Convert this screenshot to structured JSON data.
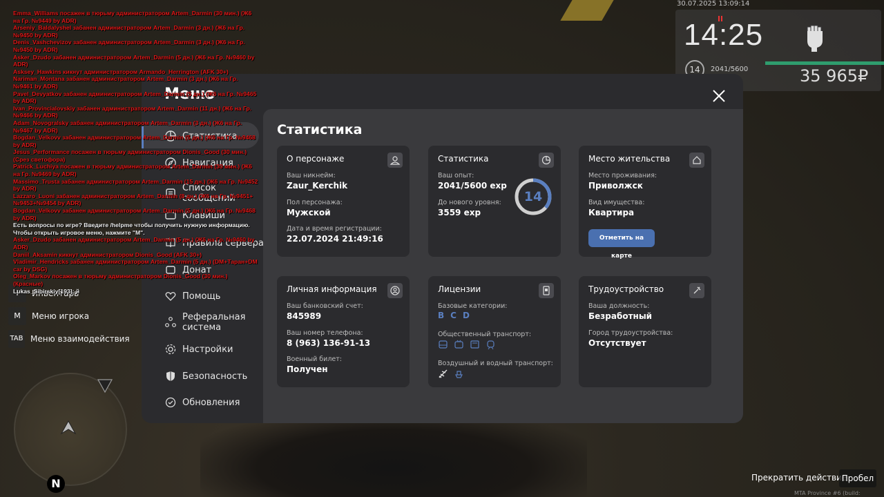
{
  "hud": {
    "datetime": "30.07.2025 13:09:14",
    "time": "14:25",
    "level": "14",
    "exp": "2041/5600",
    "money": "35 965₽"
  },
  "menu": {
    "title": "Меню",
    "nav": [
      {
        "label": "Статистика",
        "icon": "chart-icon"
      },
      {
        "label": "Навигация",
        "icon": "compass-icon"
      },
      {
        "label": "Список сообщений",
        "icon": "list-icon"
      },
      {
        "label": "Клавиши",
        "icon": "keyboard-icon"
      },
      {
        "label": "Правила сервера",
        "icon": "book-icon"
      },
      {
        "label": "Донат",
        "icon": "donate-icon"
      },
      {
        "label": "Помощь",
        "icon": "heart-hand-icon"
      },
      {
        "label": "Реферальная система",
        "icon": "referral-icon"
      },
      {
        "label": "Настройки",
        "icon": "gear-icon"
      },
      {
        "label": "Безопасность",
        "icon": "shield-icon"
      },
      {
        "label": "Обновления",
        "icon": "update-icon"
      }
    ]
  },
  "stats": {
    "title": "Статистика",
    "character": {
      "title": "О персонаже",
      "nick_label": "Ваш никнейм:",
      "nick": "Zaur_Kerchik",
      "gender_label": "Пол персонажа:",
      "gender": "Мужской",
      "reg_label": "Дата и время регистрации:",
      "reg": "22.07.2024 21:49:16"
    },
    "statistics": {
      "title": "Статистика",
      "exp_label": "Ваш опыт:",
      "exp": "2041/5600 exp",
      "next_label": "До нового уровня:",
      "next": "3559 exp",
      "level": "14",
      "progress": 0.364
    },
    "residence": {
      "title": "Место жительства",
      "place_label": "Место проживания:",
      "place": "Приволжск",
      "property_label": "Вид имущества:",
      "property": "Квартира",
      "map_button": "Отметить на карте"
    },
    "personal": {
      "title": "Личная информация",
      "bank_label": "Ваш банковский счет:",
      "bank": "845989",
      "phone_label": "Ваш номер телефона:",
      "phone": "8 (963) 136-91-13",
      "military_label": "Военный билет:",
      "military": "Получен"
    },
    "licenses": {
      "title": "Лицензии",
      "base_label": "Базовые категории:",
      "categories": [
        "B",
        "C",
        "D"
      ],
      "public_label": "Общественный транспорт:",
      "air_label": "Воздушный и водный транспорт:"
    },
    "employment": {
      "title": "Трудоустройство",
      "position_label": "Ваша должность:",
      "position": "Безработный",
      "city_label": "Город трудоустройства:",
      "city": "Отсутствует"
    }
  },
  "hotkeys": [
    {
      "key": "M",
      "label": "Меню игрока"
    },
    {
      "key": "TAB",
      "label": "Меню взаимодействия"
    },
    {
      "key": "I",
      "label": "Инвентарь"
    }
  ],
  "minimap": {
    "north": "N"
  },
  "bottom": {
    "stop_action": "Прекратить действие",
    "key": "Пробел",
    "build": "MTA Province #6 (build: 6.124.15.9)"
  },
  "chat": [
    {
      "text": "Emma_Williams посажен в тюрьму администратором Artem_Darmin (30 мин.) (Ж6 на Гр. №9449 by ADR)",
      "type": "red"
    },
    {
      "text": "Arseniy_Baldalyshel забанен администратором Artem_Darmin (3 дн.) (Ж6 на Гр. №9450 by ADR)",
      "type": "red"
    },
    {
      "text": "Denis_Vashchevizov забанен администратором Artem_Darmin (3 дн.) (Ж6 на Гр. №9450 by ADR)",
      "type": "red"
    },
    {
      "text": "Asker_Dzudo забанен администратором Artem_Darmin (5 дн.) (Ж6 на Гр. №9460 by ADR)",
      "type": "red"
    },
    {
      "text": "Asksey_Hawkins кикнут администратором Armando_Herrington (AFK 30+)",
      "type": "red"
    },
    {
      "text": "Nariman_Montana забанен администратором Artem_Darmin (3 дн.) (Ж6 на Гр. №9461 by ADR)",
      "type": "red"
    },
    {
      "text": "Pavel_Devyatkov забанен администратором Artem_Darmin (5 дн.) (Ж6 на Гр. №9465 by ADR)",
      "type": "red"
    },
    {
      "text": "Ivan_Provincialovskiy забанен администратором Artem_Darmin (11 дн.) (Ж6 на Гр. №9466 by ADR)",
      "type": "red"
    },
    {
      "text": "Adam_Novogralsky забанен администратором Artem_Darmin (3 дн.) (Ж6 на Гр. №9467 by ADR)",
      "type": "red"
    },
    {
      "text": "Bogdan_Velkovv забанен администратором Artem_Darmin (5 дн.) (Ж6 на Гр. №9468 by ADR)",
      "type": "red"
    },
    {
      "text": "Jesus_Performance посажен в тюрьму администратором Dionis_Good (30 мин.) (Срез светофора)",
      "type": "red"
    },
    {
      "text": "Patrick_Luchiya посажен в тюрьму администратором Artem_Darmin (30 мин.) (Ж6 на Гр. №9469 by ADR)",
      "type": "red"
    },
    {
      "text": "Massimo_Trusta забанен администратором Artem_Darmin (15 дн.) (Ж6 на Гр. №9452 by ADR)",
      "type": "red"
    },
    {
      "text": "Lazzaro_Luoni забанен администратором Artem_Darmin (8 дн.) (Ж6 на Гр. №9451+№9453+№9454 by ADR)",
      "type": "red"
    },
    {
      "text": "Bogdan_Velkovv забанен администратором Artem_Darmin (5 дн.) (Ж6 на Гр. №9468 by ADR)",
      "type": "red"
    },
    {
      "text": "Есть вопросы по игре? Введите /helpme чтобы получить нужную информацию.",
      "type": "white"
    },
    {
      "text": "Чтобы открыть игровое меню, нажмите \"M\".",
      "type": "white"
    },
    {
      "text": "Asker_Dzudo забанен администратором Artem_Darmin (5 дн.) (Ж6 на Гр. №9460 by ADR)",
      "type": "red"
    },
    {
      "text": "Daniil_Aksamin кикнут администратором Dionis_Good (AFK 30+)",
      "type": "red"
    },
    {
      "text": "Vladimir_Hendricks забанен администратором Artem_Darmin (5 дн.) (DM+Таран+DM car by DSG)",
      "type": "red"
    },
    {
      "text": "Oleg_Markov посажен в тюрьму администратором Dionis_Good (30 мин.) (Красные)",
      "type": "red"
    },
    {
      "text": "Lukas_Sibirskiy[193]: й",
      "type": "white"
    }
  ],
  "colors": {
    "accent": "#5a7fc0",
    "chat_red": "#e01818",
    "money_bar": "#2f9d6e"
  }
}
